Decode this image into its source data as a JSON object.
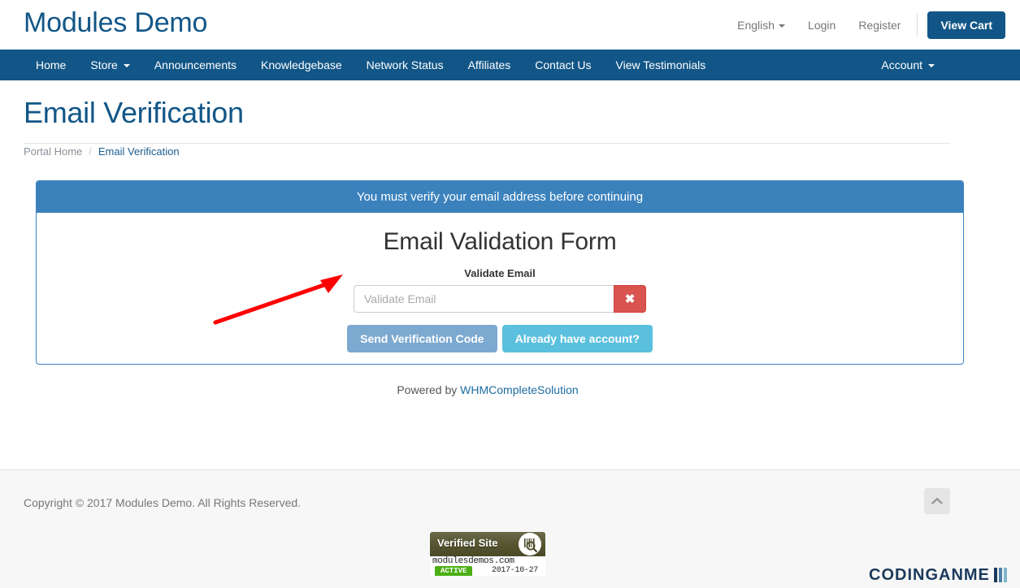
{
  "header": {
    "brand": "Modules Demo",
    "language": "English",
    "login": "Login",
    "register": "Register",
    "view_cart": "View Cart"
  },
  "nav": {
    "left_items": [
      {
        "label": "Home",
        "has_caret": false
      },
      {
        "label": "Store",
        "has_caret": true
      },
      {
        "label": "Announcements",
        "has_caret": false
      },
      {
        "label": "Knowledgebase",
        "has_caret": false
      },
      {
        "label": "Network Status",
        "has_caret": false
      },
      {
        "label": "Affiliates",
        "has_caret": false
      },
      {
        "label": "Contact Us",
        "has_caret": false
      },
      {
        "label": "View Testimonials",
        "has_caret": false
      }
    ],
    "account": "Account"
  },
  "page": {
    "title": "Email Verification"
  },
  "breadcrumb": {
    "home": "Portal Home",
    "separator": "/",
    "current": "Email Verification"
  },
  "panel": {
    "heading": "You must verify your email address before continuing",
    "form_title": "Email Validation Form",
    "field_label": "Validate Email",
    "input_value": "",
    "input_placeholder": "Validate Email",
    "clear_icon": "✖",
    "send_button": "Send Verification Code",
    "already_button": "Already have account?"
  },
  "powered_by": {
    "prefix": "Powered by ",
    "link": "WHMCompleteSolution"
  },
  "footer": {
    "copyright": "Copyright © 2017 Modules Demo. All Rights Reserved.",
    "scroll_top_icon": "chevron-up-icon"
  },
  "verified_badge": {
    "title": "Verified Site",
    "domain": "modulesdemos.com",
    "status": "ACTIVE",
    "date": "2017-10-27"
  },
  "watermark": {
    "text": "CODINGANME"
  },
  "annotation": {
    "type": "red-arrow",
    "points_to": "Validate Email input field"
  },
  "colors": {
    "brand_blue": "#125687",
    "nav_blue": "#125687",
    "panel_blue": "#3b82bd",
    "danger_red": "#d9534f",
    "send_blue": "#7ca9d0",
    "info_cyan": "#5bc0de",
    "arrow_red": "#ff0000",
    "footer_bg": "#f7f7f7"
  }
}
